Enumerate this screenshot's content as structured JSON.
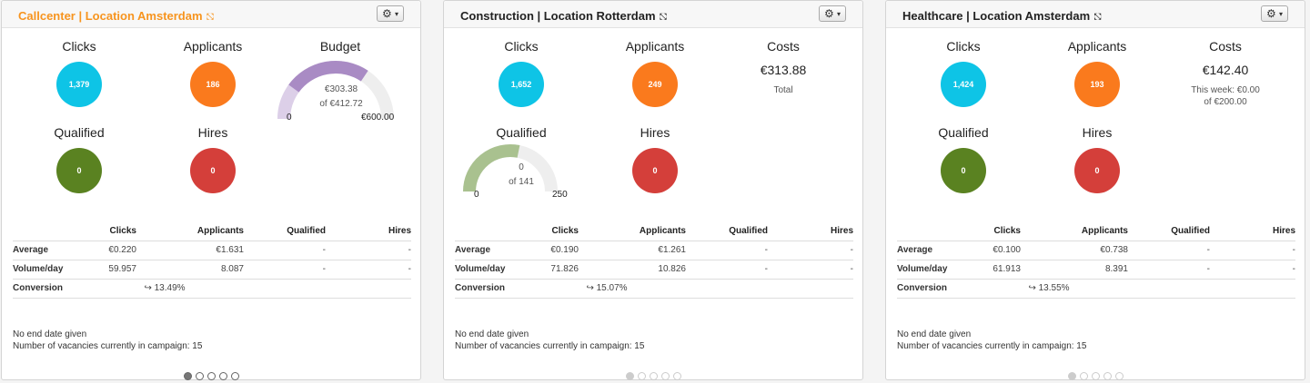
{
  "cards": [
    {
      "title": "Callcenter | Location Amsterdam",
      "title_icon": "⛞",
      "gear": "⚙",
      "caret": "▾",
      "clicks_label": "Clicks",
      "clicks": "1,379",
      "applicants_label": "Applicants",
      "applicants": "186",
      "qualified_label": "Qualified",
      "qualified": "0",
      "hires_label": "Hires",
      "hires": "0",
      "budget": {
        "label": "Budget",
        "spent": "€303.38",
        "of": "of €412.72",
        "min": "0",
        "max": "€600.00",
        "spent_value": 303.38,
        "target_value": 412.72,
        "max_value": 600
      },
      "table": {
        "headers": [
          "",
          "Clicks",
          "Applicants",
          "Qualified",
          "Hires"
        ],
        "average": [
          "Average",
          "€0.220",
          "€1.631",
          "-",
          "-"
        ],
        "volume": [
          "Volume/day",
          "59.957",
          "8.087",
          "-",
          "-"
        ],
        "conversion_label": "Conversion",
        "conversion": "↪ 13.49%"
      },
      "end_date": "No end date given",
      "vacancies": "Number of vacancies currently in campaign: 15"
    },
    {
      "title": "Construction | Location Rotterdam",
      "title_icon": "⛞",
      "gear": "⚙",
      "caret": "▾",
      "clicks_label": "Clicks",
      "clicks": "1,652",
      "applicants_label": "Applicants",
      "applicants": "249",
      "costs_label": "Costs",
      "costs": "€313.88",
      "costs_sub1": "Total",
      "qualified_label": "Qualified",
      "qualified_gauge": {
        "value": "0",
        "of": "of 141",
        "min": "0",
        "max": "250",
        "target_value": 141,
        "max_value": 250
      },
      "hires_label": "Hires",
      "hires": "0",
      "table": {
        "headers": [
          "",
          "Clicks",
          "Applicants",
          "Qualified",
          "Hires"
        ],
        "average": [
          "Average",
          "€0.190",
          "€1.261",
          "-",
          "-"
        ],
        "volume": [
          "Volume/day",
          "71.826",
          "10.826",
          "-",
          "-"
        ],
        "conversion_label": "Conversion",
        "conversion": "↪ 15.07%"
      },
      "end_date": "No end date given",
      "vacancies": "Number of vacancies currently in campaign: 15"
    },
    {
      "title": "Healthcare | Location Amsterdam",
      "title_icon": "⛞",
      "gear": "⚙",
      "caret": "▾",
      "clicks_label": "Clicks",
      "clicks": "1,424",
      "applicants_label": "Applicants",
      "applicants": "193",
      "costs_label": "Costs",
      "costs": "€142.40",
      "costs_sub1": "This week: €0.00",
      "costs_sub2": "of €200.00",
      "qualified_label": "Qualified",
      "qualified": "0",
      "hires_label": "Hires",
      "hires": "0",
      "table": {
        "headers": [
          "",
          "Clicks",
          "Applicants",
          "Qualified",
          "Hires"
        ],
        "average": [
          "Average",
          "€0.100",
          "€0.738",
          "-",
          "-"
        ],
        "volume": [
          "Volume/day",
          "61.913",
          "8.391",
          "-",
          "-"
        ],
        "conversion_label": "Conversion",
        "conversion": "↪ 13.55%"
      },
      "end_date": "No end date given",
      "vacancies": "Number of vacancies currently in campaign: 15"
    }
  ],
  "pager_active_index": 0,
  "colors": {
    "clicks": "#0ec4e6",
    "applicants": "#fa7a1d",
    "qualified": "#5a8221",
    "hires": "#d43f3a",
    "budget_spent": "#a98bc4",
    "budget_target": "#dccfe8",
    "gauge_track": "#eeeeee",
    "qualified_gauge": "#a9c18f",
    "title_highlight": "#f7941e"
  }
}
